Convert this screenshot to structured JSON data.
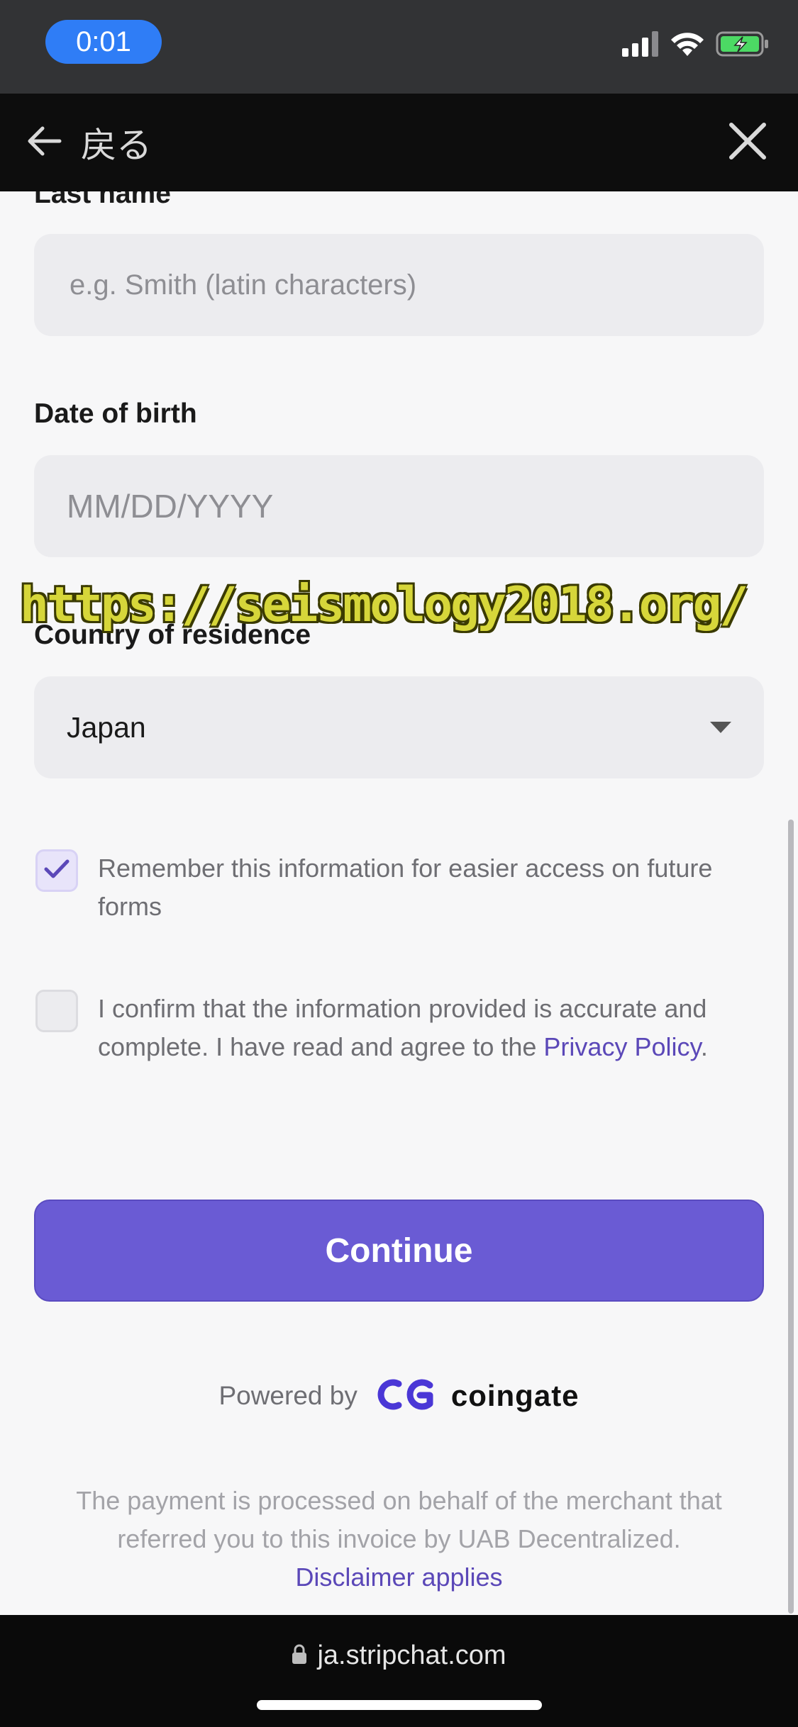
{
  "status_bar": {
    "time": "0:01"
  },
  "nav": {
    "back_label": "戻る"
  },
  "form": {
    "last_name": {
      "label": "Last name",
      "placeholder": "e.g. Smith (latin characters)"
    },
    "date_of_birth": {
      "label": "Date of birth",
      "placeholder": "MM/DD/YYYY"
    },
    "country": {
      "label": "Country of residence",
      "value": "Japan"
    },
    "remember": {
      "text": "Remember this information for easier access on future forms",
      "checked": true
    },
    "confirm": {
      "text": "I confirm that the information provided is accurate and complete. I have read and agree to the ",
      "link": "Privacy Policy",
      "suffix": ".",
      "checked": false
    },
    "continue_label": "Continue"
  },
  "powered_by": {
    "label": "Powered by",
    "brand": "coingate"
  },
  "footer": {
    "text": "The payment is processed on behalf of the merchant that referred you to this invoice by UAB Decentralized.",
    "link": "Disclaimer applies"
  },
  "watermark": "https://seismology2018.org/",
  "browser": {
    "url": "ja.stripchat.com"
  },
  "colors": {
    "accent": "#6a5bd4",
    "link": "#5b48b8",
    "time_pill": "#2f7df6",
    "battery": "#4cd964"
  },
  "icons": {
    "back": "arrow-left-icon",
    "close": "close-icon",
    "lock": "lock-icon",
    "signal": "signal-icon",
    "wifi": "wifi-icon",
    "battery": "battery-icon",
    "check": "checkmark-icon",
    "caret": "chevron-down-icon",
    "brand": "coingate-logo-icon"
  }
}
